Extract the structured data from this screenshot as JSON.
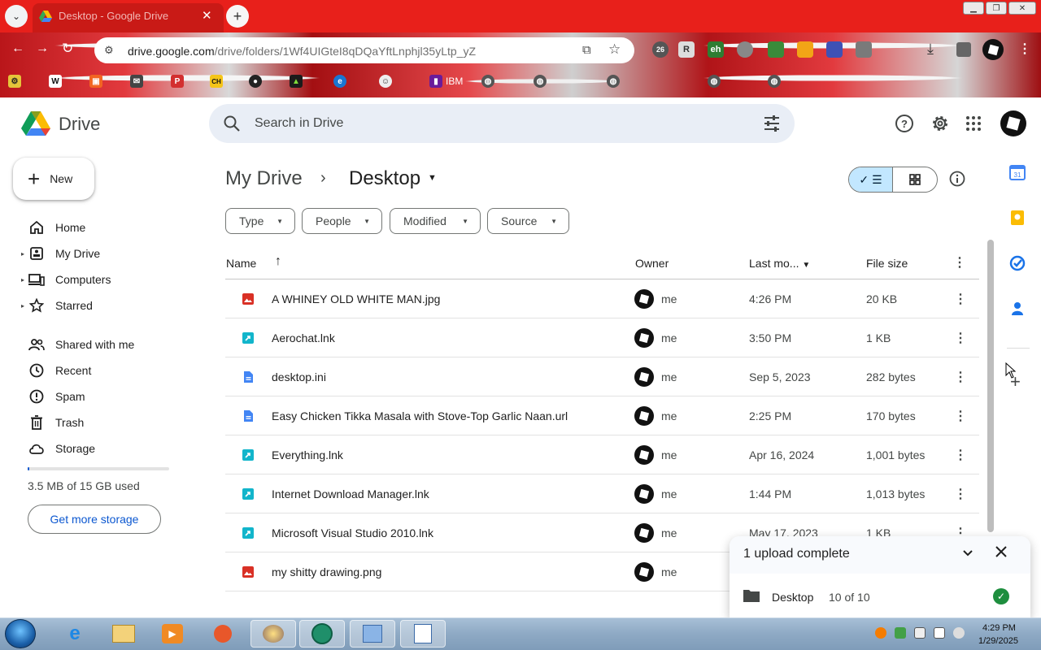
{
  "browser": {
    "tab_title": "Desktop - Google Drive",
    "url_host": "drive.google.com",
    "url_path": "/drive/folders/1Wf4UIGteI8qDQaYftLnphjl35yLtp_yZ",
    "tab_close": "✕",
    "new_tab": "+",
    "extensions": {
      "badge_count": "26",
      "r_label": "R",
      "eh_label": "eh"
    },
    "bookmarks": [
      {
        "label": "",
        "icon": "W"
      },
      {
        "label": "",
        "icon": "CH"
      },
      {
        "label": "IBM",
        "icon": ""
      },
      {
        "label": "",
        "icon": ""
      },
      {
        "label": "",
        "icon": ""
      },
      {
        "label": "",
        "icon": ""
      }
    ],
    "accent": "#e8201b"
  },
  "drive": {
    "app_name": "Drive",
    "search_placeholder": "Search in Drive",
    "new_label": "New",
    "nav": [
      {
        "label": "Home",
        "icon": "home-icon"
      },
      {
        "label": "My Drive",
        "icon": "my-drive-icon"
      },
      {
        "label": "Computers",
        "icon": "computers-icon"
      },
      {
        "label": "Starred",
        "icon": "star-icon"
      },
      {
        "label": "Shared with me",
        "icon": "shared-icon"
      },
      {
        "label": "Recent",
        "icon": "clock-icon"
      },
      {
        "label": "Spam",
        "icon": "spam-icon"
      },
      {
        "label": "Trash",
        "icon": "trash-icon"
      },
      {
        "label": "Storage",
        "icon": "cloud-icon"
      }
    ],
    "storage_used_text": "3.5 MB of 15 GB used",
    "storage_used_fraction": 0.0002,
    "get_storage_label": "Get more storage",
    "breadcrumb": {
      "root": "My Drive",
      "separator": "›",
      "current": "Desktop"
    },
    "filters": [
      "Type",
      "People",
      "Modified",
      "Source"
    ],
    "columns": {
      "name": "Name",
      "owner": "Owner",
      "modified": "Last mo...",
      "size": "File size"
    },
    "files": [
      {
        "name": "A WHINEY OLD WHITE MAN.jpg",
        "type": "image",
        "owner": "me",
        "modified": "4:26 PM",
        "size": "20 KB"
      },
      {
        "name": "Aerochat.lnk",
        "type": "shortcut",
        "owner": "me",
        "modified": "3:50 PM",
        "size": "1 KB"
      },
      {
        "name": "desktop.ini",
        "type": "doc",
        "owner": "me",
        "modified": "Sep 5, 2023",
        "size": "282 bytes"
      },
      {
        "name": "Easy Chicken Tikka Masala with Stove-Top Garlic Naan.url",
        "type": "doc",
        "owner": "me",
        "modified": "2:25 PM",
        "size": "170 bytes"
      },
      {
        "name": "Everything.lnk",
        "type": "shortcut",
        "owner": "me",
        "modified": "Apr 16, 2024",
        "size": "1,001 bytes"
      },
      {
        "name": "Internet Download Manager.lnk",
        "type": "shortcut",
        "owner": "me",
        "modified": "1:44 PM",
        "size": "1,013 bytes"
      },
      {
        "name": "Microsoft Visual Studio 2010.lnk",
        "type": "shortcut",
        "owner": "me",
        "modified": "May 17, 2023",
        "size": "1 KB"
      },
      {
        "name": "my shitty drawing.png",
        "type": "image",
        "owner": "me",
        "modified": "",
        "size": ""
      }
    ],
    "upload": {
      "title": "1 upload complete",
      "item_name": "Desktop",
      "item_count": "10 of 10"
    },
    "colors": {
      "image_icon": "#d93025",
      "shortcut_icon": "#12b5cb",
      "doc_icon": "#4285f4",
      "selected_view": "#c2e7ff"
    }
  },
  "taskbar": {
    "time": "4:29 PM",
    "date": "1/29/2025"
  }
}
